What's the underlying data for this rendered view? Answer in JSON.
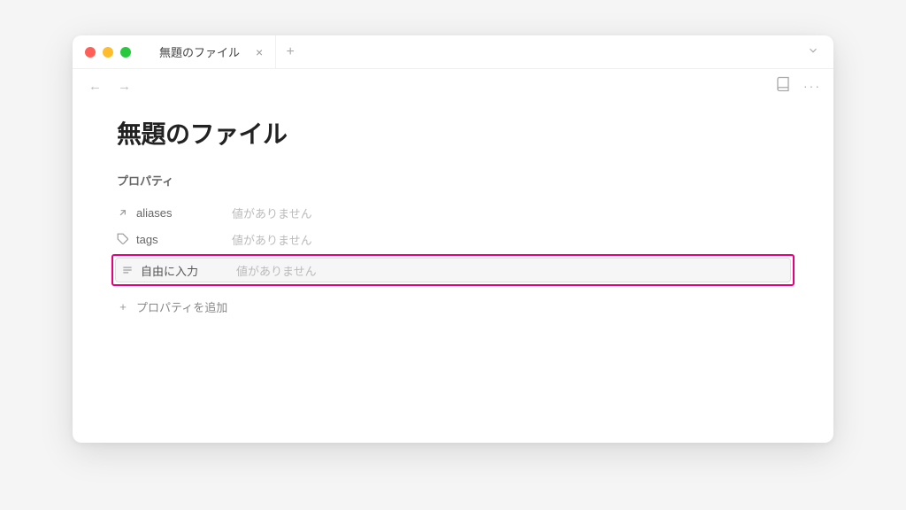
{
  "tab": {
    "title": "無題のファイル"
  },
  "page": {
    "title": "無題のファイル"
  },
  "properties": {
    "section_label": "プロパティ",
    "rows": [
      {
        "key": "aliases",
        "value": "値がありません"
      },
      {
        "key": "tags",
        "value": "値がありません"
      },
      {
        "key": "自由に入力",
        "value": "値がありません"
      }
    ],
    "add_label": "プロパティを追加"
  }
}
